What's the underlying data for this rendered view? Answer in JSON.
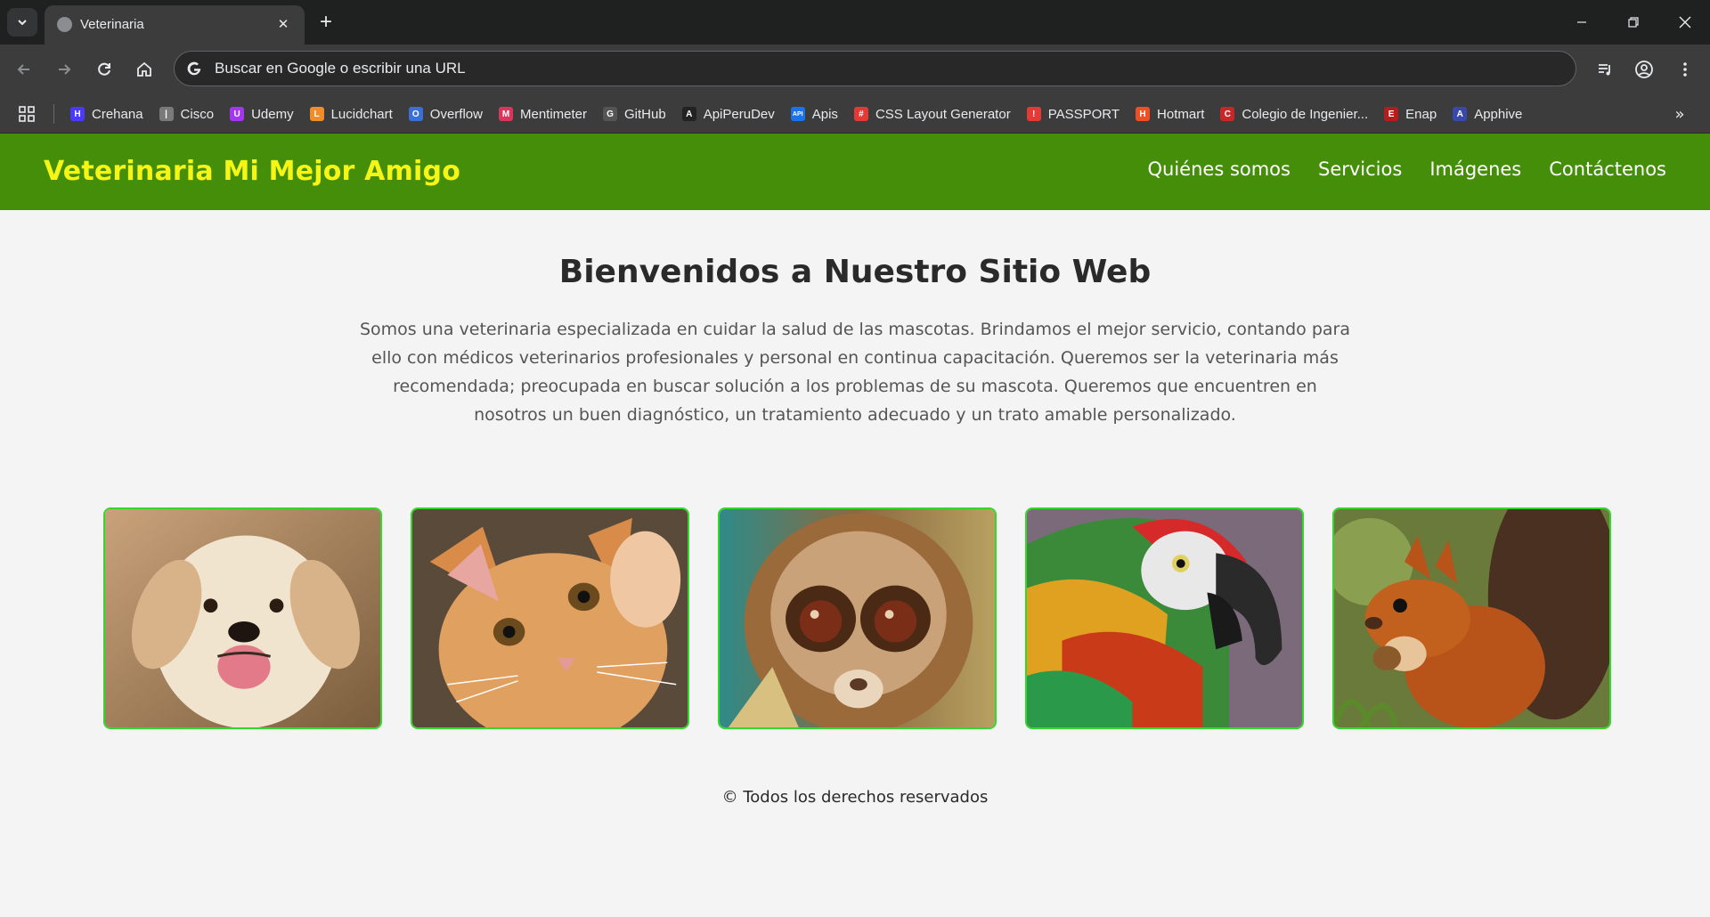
{
  "browser": {
    "tab_title": "Veterinaria",
    "omnibox_placeholder": "Buscar en Google o escribir una URL",
    "bookmarks": [
      {
        "label": "Crehana",
        "icon": "crehana-icon",
        "color": "#4a3aff",
        "glyph": "H"
      },
      {
        "label": "Cisco",
        "icon": "cisco-icon",
        "color": "#7a7a7a",
        "glyph": "|"
      },
      {
        "label": "Udemy",
        "icon": "udemy-icon",
        "color": "#a435f0",
        "glyph": "U"
      },
      {
        "label": "Lucidchart",
        "icon": "lucidchart-icon",
        "color": "#f28c28",
        "glyph": "L"
      },
      {
        "label": "Overflow",
        "icon": "overflow-icon",
        "color": "#3a6fd8",
        "glyph": "O"
      },
      {
        "label": "Mentimeter",
        "icon": "mentimeter-icon",
        "color": "#d9365e",
        "glyph": "M"
      },
      {
        "label": "GitHub",
        "icon": "github-icon",
        "color": "#555555",
        "glyph": "G"
      },
      {
        "label": "ApiPeruDev",
        "icon": "apiperudev-icon",
        "color": "#222222",
        "glyph": "A"
      },
      {
        "label": "Apis",
        "icon": "apis-icon",
        "color": "#1a73e8",
        "glyph": "API"
      },
      {
        "label": "CSS Layout Generator",
        "icon": "css-layout-generator-icon",
        "color": "#e53935",
        "glyph": "#"
      },
      {
        "label": "PASSPORT",
        "icon": "passport-icon",
        "color": "#e53935",
        "glyph": "!"
      },
      {
        "label": "Hotmart",
        "icon": "hotmart-icon",
        "color": "#f04e23",
        "glyph": "H"
      },
      {
        "label": "Colegio de Ingenier...",
        "icon": "colegio-icon",
        "color": "#c62828",
        "glyph": "C"
      },
      {
        "label": "Enap",
        "icon": "enap-icon",
        "color": "#b71c1c",
        "glyph": "E"
      },
      {
        "label": "Apphive",
        "icon": "apphive-icon",
        "color": "#3949ab",
        "glyph": "A"
      }
    ]
  },
  "site": {
    "logo": "Veterinaria Mi Mejor Amigo",
    "nav": [
      "Quiénes somos",
      "Servicios",
      "Imágenes",
      "Contáctenos"
    ],
    "title": "Bienvenidos a Nuestro Sitio Web",
    "intro": "Somos una veterinaria especializada en cuidar la salud de las mascotas. Brindamos el mejor servicio, contando para ello con médicos veterinarios profesionales y personal en continua capacitación. Queremos ser la veterinaria más recomendada; preocupada en buscar solución a los problemas de su mascota. Queremos que encuentren en nosotros un buen diagnóstico, un tratamiento adecuado y un trato amable personalizado.",
    "gallery": [
      {
        "name": "puppy-photo",
        "animal": "dog"
      },
      {
        "name": "kitten-photo",
        "animal": "cat"
      },
      {
        "name": "loris-photo",
        "animal": "loris"
      },
      {
        "name": "macaw-photo",
        "animal": "parrot"
      },
      {
        "name": "squirrel-photo",
        "animal": "squirrel"
      }
    ],
    "footer": "© Todos los derechos reservados"
  },
  "colors": {
    "header_bg": "#448e0a",
    "logo": "#f6f616",
    "card_border": "#36d62e"
  }
}
